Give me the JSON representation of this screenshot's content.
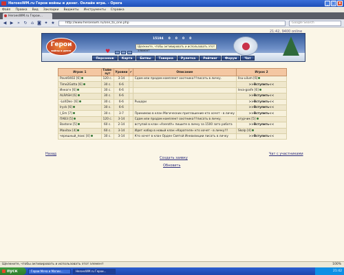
{
  "window": {
    "title": "HeroesWM.ru Герои войны и денег. Онлайн игра. - Opera"
  },
  "menu": [
    "Файл",
    "Правка",
    "Вид",
    "Закладки",
    "Виджеты",
    "Инструменты",
    "Справка"
  ],
  "tab": {
    "label": "HeroesWM.ru Герои..."
  },
  "nav": {
    "address": "http://www.heroeswm.ru/one_to_one.php",
    "search_placeholder": "Google Search"
  },
  "page": {
    "online": "21:42, 9400 online",
    "logo": "Герои",
    "logo_sub": "войны и денег",
    "stats": [
      "15194",
      "0",
      "0",
      "0",
      "0"
    ],
    "flash_hint": "Щелкните, чтобы активировать и использовать этот элемент",
    "nav_items": [
      "Персонаж",
      "Карта",
      "Битвы",
      "Таверна",
      "Рулетка",
      "Рейтинг",
      "Форум",
      "Чат"
    ]
  },
  "table": {
    "headers": [
      "Игрок 1",
      "Тайм-аут",
      "Уровни",
      "",
      "Описание",
      "Игрок 2"
    ],
    "rows": [
      {
        "p1": "Pavel0402 [6]",
        "t": "120 с.",
        "lv": "3-14",
        "desc": "Сдам или продам комплект охотника!!!писать в личку.",
        "p2": "llsu-uilum [6]"
      },
      {
        "p1": "Time2Gotta [6]",
        "t": "30 с.",
        "lv": "6-6",
        "desc": "",
        "p2": ">>Вступить<<"
      },
      {
        "p1": "Инкогн [6]",
        "t": "30 с.",
        "lv": "6-6",
        "desc": "",
        "p2": "leva-gosfe [6]"
      },
      {
        "p1": "ALRASH [6]",
        "t": "30 с.",
        "lv": "6-6",
        "desc": "",
        "p2": ">>Вступить<<"
      },
      {
        "p1": "-LoXDes- [6]",
        "t": "30 с.",
        "lv": "6-6",
        "desc": "Рыцари",
        "p2": ">>Вступить<<"
      },
      {
        "p1": "Iryck [6]",
        "t": "30 с.",
        "lv": "6-6",
        "desc": "",
        "p2": ">>Вступить<<"
      },
      {
        "p1": "I_Em [7]",
        "t": "30 с.",
        "lv": "3-7",
        "desc": "Принимаю в клан Магических приглашение-кто хочет - в личку",
        "p2": ">>Вступить<<"
      },
      {
        "p1": "ПАВ3 [5]",
        "t": "120 с.",
        "lv": "3-14",
        "desc": "Сдам или продам комплект охотника!!!писать в личку.",
        "p2": "огурчик [5]"
      },
      {
        "p1": "Bastone [5]",
        "t": "60 с.",
        "lv": "2-14",
        "desc": "вступай в клан «Азеroth» пишите в личку за 1500 зато работа",
        "p2": ">>Вступить<<"
      },
      {
        "p1": "Maxitox [4]",
        "t": "60 с.",
        "lv": "3-14",
        "desc": "Идет набор в новый клан «Карателя» кто хочет - в личку!!!",
        "p2": "Skolp [4]"
      },
      {
        "p1": "черешный_поис [4]",
        "t": "30 с.",
        "lv": "3-14",
        "desc": "Кто хочет в клан Орден Святой Инквизиции писать в личку",
        "p2": ">>Вступить<<"
      }
    ]
  },
  "links": {
    "back": "Назад",
    "create": "Создать заявку",
    "refresh": "Обновить",
    "chat": "Чат с участниками"
  },
  "status": {
    "text": "Щелкните, чтобы активировать и использовать этот элемент",
    "zoom": "100%"
  },
  "taskbar": {
    "start": "пуск",
    "items": [
      "Герои Меча и Магии...",
      "HeroesWM.ru Герои..."
    ],
    "clock": "21:42"
  }
}
